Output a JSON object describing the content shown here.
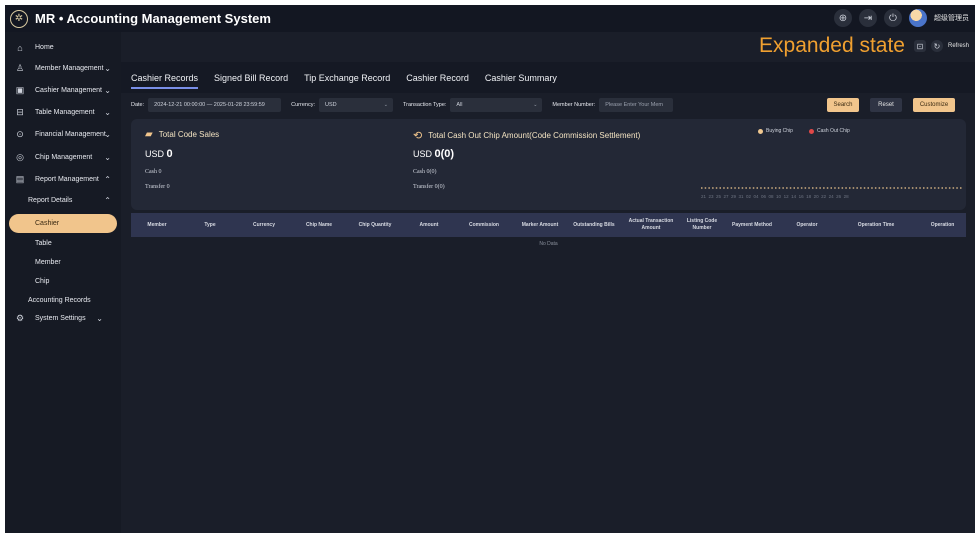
{
  "app": {
    "title": "MR • Accounting Management System",
    "username": "超级管理员"
  },
  "annotation": "Expanded state",
  "main_actions": {
    "refresh_label": "Refresh"
  },
  "sidebar": {
    "items": [
      {
        "label": "Home",
        "icon": "home-icon"
      },
      {
        "label": "Member Management",
        "icon": "members-icon"
      },
      {
        "label": "Cashier Management",
        "icon": "cashier-icon"
      },
      {
        "label": "Table Management",
        "icon": "table-icon"
      },
      {
        "label": "Financial Management",
        "icon": "finance-icon"
      },
      {
        "label": "Chip Management",
        "icon": "chip-icon"
      },
      {
        "label": "Report Management",
        "icon": "report-icon"
      }
    ],
    "report_details": "Report Details",
    "sub_items": [
      "Cashier",
      "Table",
      "Member",
      "Chip"
    ],
    "accounting_records": "Accounting Records",
    "system_settings": "System Settings"
  },
  "tabs": [
    "Cashier Records",
    "Signed Bill Record",
    "Tip Exchange Record",
    "Cashier Record",
    "Cashier Summary"
  ],
  "filters": {
    "date_label": "Date:",
    "date_value": "2024-12-21 00:00:00  —  2025-01-28 23:59:59",
    "currency_label": "Currency:",
    "currency_value": "USD",
    "transaction_type_label": "Transaction Type:",
    "transaction_type_value": "All",
    "member_number_label": "Member Number:",
    "member_number_placeholder": "Please Enter Your Mem",
    "search_label": "Search",
    "reset_label": "Reset",
    "customize_label": "Customize"
  },
  "stats": {
    "left": {
      "title": "Total Code Sales",
      "currency": "USD",
      "amount": "0",
      "cash": "Cash  0",
      "transfer": "Transfer  0"
    },
    "right": {
      "title": "Total Cash Out Chip Amount(Code Commission Settlement)",
      "currency": "USD",
      "amount": "0(0)",
      "cash": "Cash  0(0)",
      "transfer": "Transfer  0(0)"
    },
    "legend": [
      {
        "label": "Buying Chip",
        "color": "#f0c890"
      },
      {
        "label": "Cash Out Chip",
        "color": "#e04848"
      }
    ],
    "chart_axis": "21  23  25  27  29  31  02  04  06  08  10  12  14  16  18  20  22  24  26  28"
  },
  "table": {
    "columns": [
      "Member",
      "Type",
      "Currency",
      "Chip Name",
      "Chip Quantity",
      "Amount",
      "Commission",
      "Marker Amount",
      "Outstanding Bills",
      "Actual Transaction Amount",
      "Listing Code Number",
      "Payment Method",
      "Operator",
      "Operation Time",
      "Operation"
    ],
    "empty_text": "No Data"
  }
}
